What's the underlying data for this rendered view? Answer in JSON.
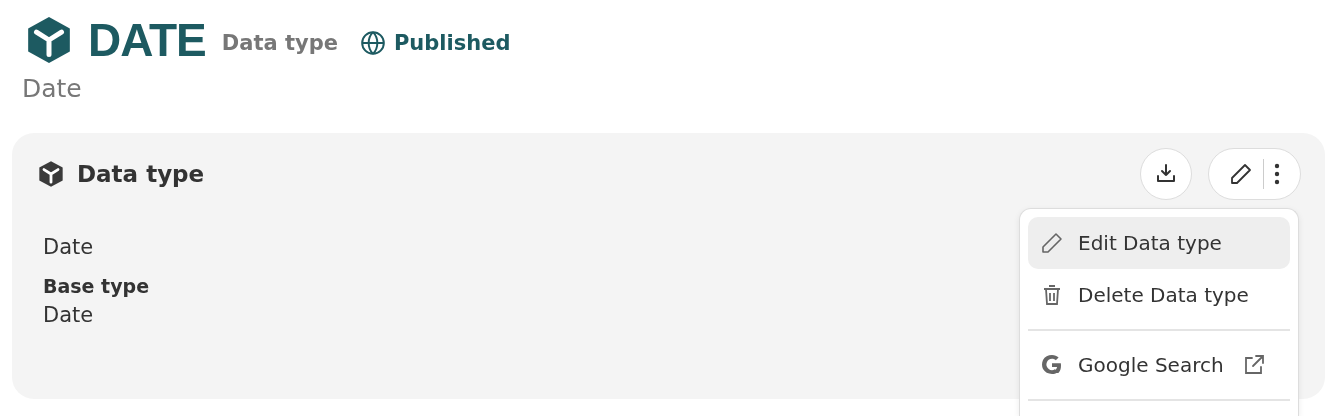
{
  "header": {
    "title": "DATE",
    "type_label": "Data type",
    "status": "Published",
    "subtitle": "Date"
  },
  "card": {
    "title": "Data type",
    "value": "Date",
    "fields": [
      {
        "label": "Base type",
        "value": "Date"
      }
    ]
  },
  "menu": {
    "items": [
      {
        "kind": "edit",
        "label": "Edit Data type",
        "selected": true
      },
      {
        "kind": "delete",
        "label": "Delete Data type",
        "selected": false
      },
      {
        "kind": "divider"
      },
      {
        "kind": "search",
        "label": "Google Search",
        "selected": false,
        "external": true
      },
      {
        "kind": "divider"
      }
    ]
  }
}
